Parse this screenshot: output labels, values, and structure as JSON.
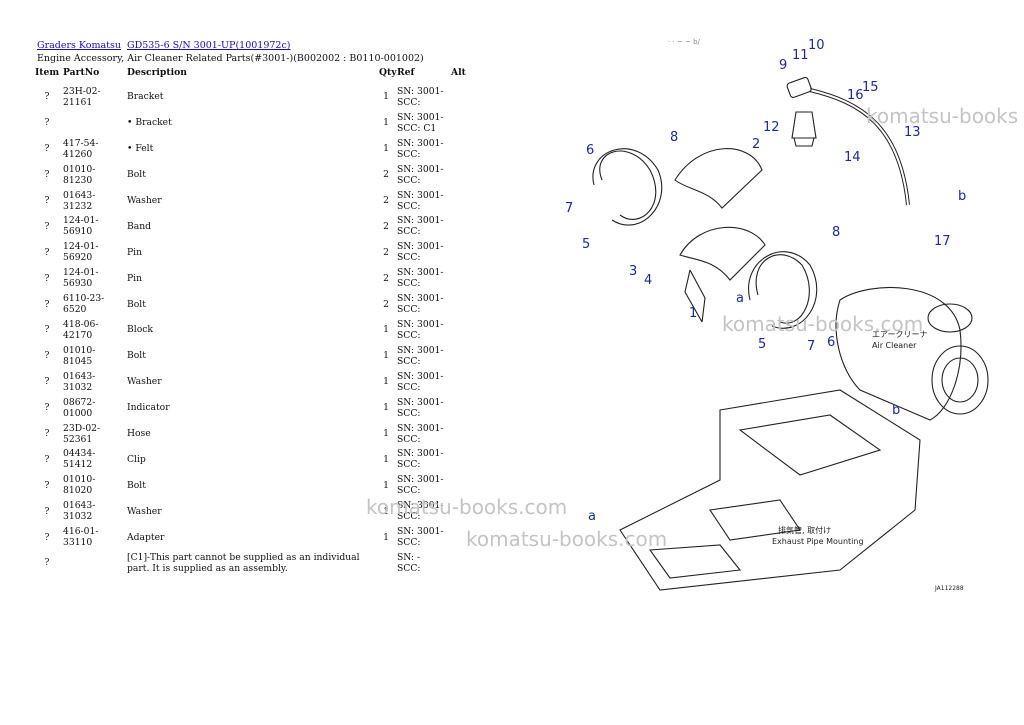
{
  "breadcrumb": {
    "link1": "Graders Komatsu",
    "link2": "GD535-6 S/N  3001-UP(1001972c)"
  },
  "subtitle": "Engine Accessory, Air Cleaner Related Parts(#3001-)(B002002 : B0110-001002)",
  "table": {
    "headers": {
      "item": "Item",
      "partno": "PartNo",
      "description": "Description",
      "qty": "Qty",
      "ref": "Ref",
      "alt": "Alt"
    },
    "rows": [
      {
        "item": "?",
        "partno": "23H-02-21161",
        "description": "Bracket",
        "qty": "1",
        "ref": "SN: 3001-\nSCC:"
      },
      {
        "item": "?",
        "partno": "",
        "description": "• Bracket",
        "qty": "1",
        "ref": "SN: 3001-\nSCC: C1"
      },
      {
        "item": "?",
        "partno": "417-54-41260",
        "description": "• Felt",
        "qty": "1",
        "ref": "SN: 3001-\nSCC:"
      },
      {
        "item": "?",
        "partno": "01010-81230",
        "description": "Bolt",
        "qty": "2",
        "ref": "SN: 3001-\nSCC:"
      },
      {
        "item": "?",
        "partno": "01643-31232",
        "description": "Washer",
        "qty": "2",
        "ref": "SN: 3001-\nSCC:"
      },
      {
        "item": "?",
        "partno": "124-01-56910",
        "description": "Band",
        "qty": "2",
        "ref": "SN: 3001-\nSCC:"
      },
      {
        "item": "?",
        "partno": "124-01-56920",
        "description": "Pin",
        "qty": "2",
        "ref": "SN: 3001-\nSCC:"
      },
      {
        "item": "?",
        "partno": "124-01-56930",
        "description": "Pin",
        "qty": "2",
        "ref": "SN: 3001-\nSCC:"
      },
      {
        "item": "?",
        "partno": "6110-23-6520",
        "description": "Bolt",
        "qty": "2",
        "ref": "SN: 3001-\nSCC:"
      },
      {
        "item": "?",
        "partno": "418-06-42170",
        "description": "Block",
        "qty": "1",
        "ref": "SN: 3001-\nSCC:"
      },
      {
        "item": "?",
        "partno": "01010-81045",
        "description": "Bolt",
        "qty": "1",
        "ref": "SN: 3001-\nSCC:"
      },
      {
        "item": "?",
        "partno": "01643-31032",
        "description": "Washer",
        "qty": "1",
        "ref": "SN: 3001-\nSCC:"
      },
      {
        "item": "?",
        "partno": "08672-01000",
        "description": "Indicator",
        "qty": "1",
        "ref": "SN: 3001-\nSCC:"
      },
      {
        "item": "?",
        "partno": "23D-02-52361",
        "description": "Hose",
        "qty": "1",
        "ref": "SN: 3001-\nSCC:"
      },
      {
        "item": "?",
        "partno": "04434-51412",
        "description": "Clip",
        "qty": "1",
        "ref": "SN: 3001-\nSCC:"
      },
      {
        "item": "?",
        "partno": "01010-81020",
        "description": "Bolt",
        "qty": "1",
        "ref": "SN: 3001-\nSCC:"
      },
      {
        "item": "?",
        "partno": "01643-31032",
        "description": "Washer",
        "qty": "1",
        "ref": "SN: 3001-\nSCC:"
      },
      {
        "item": "?",
        "partno": "416-01-33110",
        "description": "Adapter",
        "qty": "1",
        "ref": "SN: 3001-\nSCC:"
      },
      {
        "item": "?",
        "partno": "",
        "description": "[C1]-This part cannot be supplied as an individual part. It is supplied as an assembly.",
        "qty": "",
        "ref": "SN: -\nSCC:"
      }
    ]
  },
  "diagram": {
    "callouts": [
      "10",
      "11",
      "9",
      "15",
      "16",
      "12",
      "13",
      "14",
      "8",
      "2",
      "6",
      "7",
      "5",
      "b",
      "17",
      "8",
      "3",
      "4",
      "a",
      "1",
      "5",
      "7",
      "6",
      "b",
      "a"
    ],
    "label_air_jp": "エアークリーナ",
    "label_air_en": "Air Cleaner",
    "label_exhaust_jp": "排気管, 取付け",
    "label_exhaust_en": "Exhaust Pipe Mounting",
    "drawing_id": "JA112288",
    "corner_mark": "· · ~ ~ b/"
  },
  "watermark": {
    "text1": "komatsu-books",
    "text2": "komatsu-books.com",
    "text3": "komatsu-books.com",
    "text4": "komatsu-books.com"
  }
}
